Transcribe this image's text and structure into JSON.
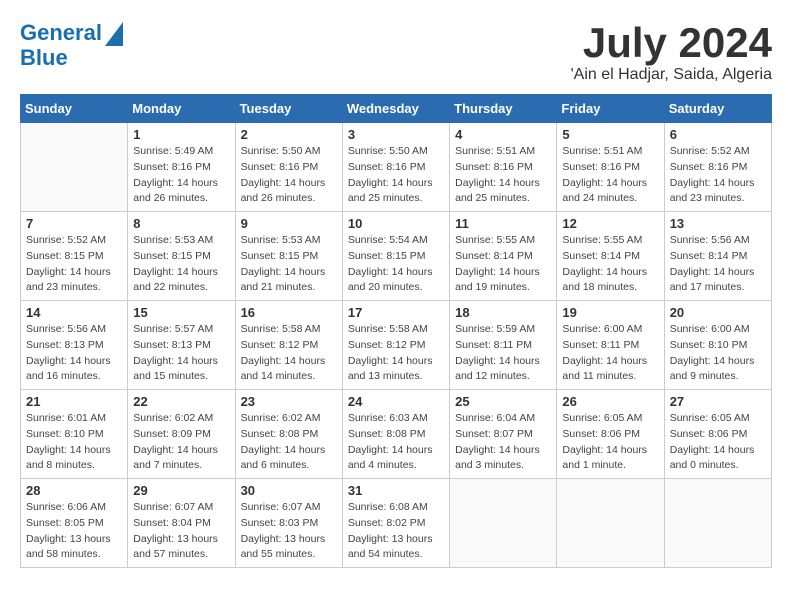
{
  "header": {
    "logo_line1": "General",
    "logo_line2": "Blue",
    "month": "July 2024",
    "location": "'Ain el Hadjar, Saida, Algeria"
  },
  "columns": [
    "Sunday",
    "Monday",
    "Tuesday",
    "Wednesday",
    "Thursday",
    "Friday",
    "Saturday"
  ],
  "weeks": [
    [
      {
        "day": "",
        "detail": ""
      },
      {
        "day": "1",
        "detail": "Sunrise: 5:49 AM\nSunset: 8:16 PM\nDaylight: 14 hours\nand 26 minutes."
      },
      {
        "day": "2",
        "detail": "Sunrise: 5:50 AM\nSunset: 8:16 PM\nDaylight: 14 hours\nand 26 minutes."
      },
      {
        "day": "3",
        "detail": "Sunrise: 5:50 AM\nSunset: 8:16 PM\nDaylight: 14 hours\nand 25 minutes."
      },
      {
        "day": "4",
        "detail": "Sunrise: 5:51 AM\nSunset: 8:16 PM\nDaylight: 14 hours\nand 25 minutes."
      },
      {
        "day": "5",
        "detail": "Sunrise: 5:51 AM\nSunset: 8:16 PM\nDaylight: 14 hours\nand 24 minutes."
      },
      {
        "day": "6",
        "detail": "Sunrise: 5:52 AM\nSunset: 8:16 PM\nDaylight: 14 hours\nand 23 minutes."
      }
    ],
    [
      {
        "day": "7",
        "detail": "Sunrise: 5:52 AM\nSunset: 8:15 PM\nDaylight: 14 hours\nand 23 minutes."
      },
      {
        "day": "8",
        "detail": "Sunrise: 5:53 AM\nSunset: 8:15 PM\nDaylight: 14 hours\nand 22 minutes."
      },
      {
        "day": "9",
        "detail": "Sunrise: 5:53 AM\nSunset: 8:15 PM\nDaylight: 14 hours\nand 21 minutes."
      },
      {
        "day": "10",
        "detail": "Sunrise: 5:54 AM\nSunset: 8:15 PM\nDaylight: 14 hours\nand 20 minutes."
      },
      {
        "day": "11",
        "detail": "Sunrise: 5:55 AM\nSunset: 8:14 PM\nDaylight: 14 hours\nand 19 minutes."
      },
      {
        "day": "12",
        "detail": "Sunrise: 5:55 AM\nSunset: 8:14 PM\nDaylight: 14 hours\nand 18 minutes."
      },
      {
        "day": "13",
        "detail": "Sunrise: 5:56 AM\nSunset: 8:14 PM\nDaylight: 14 hours\nand 17 minutes."
      }
    ],
    [
      {
        "day": "14",
        "detail": "Sunrise: 5:56 AM\nSunset: 8:13 PM\nDaylight: 14 hours\nand 16 minutes."
      },
      {
        "day": "15",
        "detail": "Sunrise: 5:57 AM\nSunset: 8:13 PM\nDaylight: 14 hours\nand 15 minutes."
      },
      {
        "day": "16",
        "detail": "Sunrise: 5:58 AM\nSunset: 8:12 PM\nDaylight: 14 hours\nand 14 minutes."
      },
      {
        "day": "17",
        "detail": "Sunrise: 5:58 AM\nSunset: 8:12 PM\nDaylight: 14 hours\nand 13 minutes."
      },
      {
        "day": "18",
        "detail": "Sunrise: 5:59 AM\nSunset: 8:11 PM\nDaylight: 14 hours\nand 12 minutes."
      },
      {
        "day": "19",
        "detail": "Sunrise: 6:00 AM\nSunset: 8:11 PM\nDaylight: 14 hours\nand 11 minutes."
      },
      {
        "day": "20",
        "detail": "Sunrise: 6:00 AM\nSunset: 8:10 PM\nDaylight: 14 hours\nand 9 minutes."
      }
    ],
    [
      {
        "day": "21",
        "detail": "Sunrise: 6:01 AM\nSunset: 8:10 PM\nDaylight: 14 hours\nand 8 minutes."
      },
      {
        "day": "22",
        "detail": "Sunrise: 6:02 AM\nSunset: 8:09 PM\nDaylight: 14 hours\nand 7 minutes."
      },
      {
        "day": "23",
        "detail": "Sunrise: 6:02 AM\nSunset: 8:08 PM\nDaylight: 14 hours\nand 6 minutes."
      },
      {
        "day": "24",
        "detail": "Sunrise: 6:03 AM\nSunset: 8:08 PM\nDaylight: 14 hours\nand 4 minutes."
      },
      {
        "day": "25",
        "detail": "Sunrise: 6:04 AM\nSunset: 8:07 PM\nDaylight: 14 hours\nand 3 minutes."
      },
      {
        "day": "26",
        "detail": "Sunrise: 6:05 AM\nSunset: 8:06 PM\nDaylight: 14 hours\nand 1 minute."
      },
      {
        "day": "27",
        "detail": "Sunrise: 6:05 AM\nSunset: 8:06 PM\nDaylight: 14 hours\nand 0 minutes."
      }
    ],
    [
      {
        "day": "28",
        "detail": "Sunrise: 6:06 AM\nSunset: 8:05 PM\nDaylight: 13 hours\nand 58 minutes."
      },
      {
        "day": "29",
        "detail": "Sunrise: 6:07 AM\nSunset: 8:04 PM\nDaylight: 13 hours\nand 57 minutes."
      },
      {
        "day": "30",
        "detail": "Sunrise: 6:07 AM\nSunset: 8:03 PM\nDaylight: 13 hours\nand 55 minutes."
      },
      {
        "day": "31",
        "detail": "Sunrise: 6:08 AM\nSunset: 8:02 PM\nDaylight: 13 hours\nand 54 minutes."
      },
      {
        "day": "",
        "detail": ""
      },
      {
        "day": "",
        "detail": ""
      },
      {
        "day": "",
        "detail": ""
      }
    ]
  ]
}
